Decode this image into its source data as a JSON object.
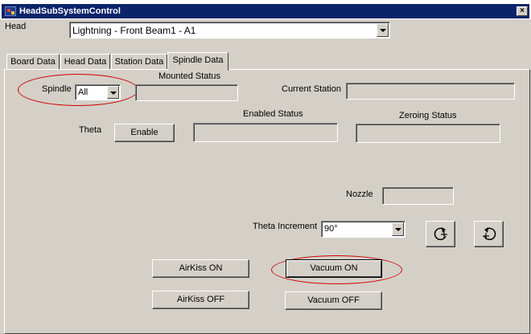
{
  "window": {
    "title": "HeadSubSystemControl",
    "close_glyph": "×"
  },
  "head": {
    "label": "Head",
    "selected": "Lightning  -  Front Beam1  -  A1"
  },
  "tabs": [
    {
      "label": "Board Data"
    },
    {
      "label": "Head Data"
    },
    {
      "label": "Station Data"
    },
    {
      "label": "Spindle Data",
      "active": true
    }
  ],
  "spindle": {
    "label": "Spindle",
    "selected": "All",
    "mounted_status_label": "Mounted Status",
    "mounted_status_value": "",
    "current_station_label": "Current Station",
    "current_station_value": ""
  },
  "theta": {
    "label": "Theta",
    "enable_button": "Enable",
    "enabled_status_label": "Enabled Status",
    "enabled_status_value": "",
    "zeroing_status_label": "Zeroing Status",
    "zeroing_status_value": ""
  },
  "nozzle": {
    "label": "Nozzle",
    "value": ""
  },
  "theta_increment": {
    "label": "Theta Increment",
    "selected": "90°"
  },
  "rotate": {
    "ccw_icon": "rotate-ccw-icon",
    "cw_icon": "rotate-cw-icon"
  },
  "buttons": {
    "airkiss_on": "AirKiss ON",
    "airkiss_off": "AirKiss OFF",
    "vacuum_on": "Vacuum ON",
    "vacuum_off": "Vacuum OFF"
  },
  "colors": {
    "titlebar": "#0a246a",
    "face": "#d4d0c8",
    "highlight_ellipse": "#d00000"
  }
}
